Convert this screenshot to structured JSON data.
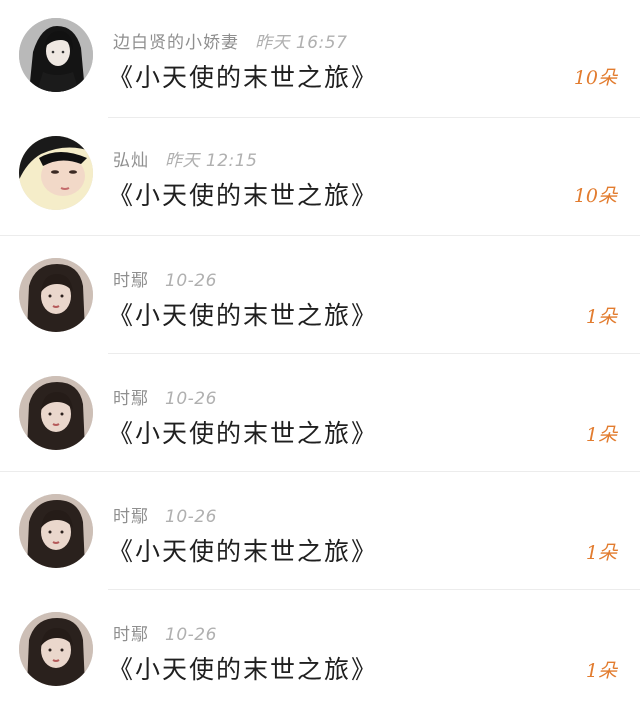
{
  "items": [
    {
      "name": "边白贤的小娇妻",
      "time": "昨天 16:57",
      "title": "《小天使的末世之旅》",
      "count": "10朵"
    },
    {
      "name": "弘灿",
      "time": "昨天 12:15",
      "title": "《小天使的末世之旅》",
      "count": "10朵"
    },
    {
      "name": "时鄢",
      "time": "10-26",
      "title": "《小天使的末世之旅》",
      "count": "1朵"
    },
    {
      "name": "时鄢",
      "time": "10-26",
      "title": "《小天使的末世之旅》",
      "count": "1朵"
    },
    {
      "name": "时鄢",
      "time": "10-26",
      "title": "《小天使的末世之旅》",
      "count": "1朵"
    },
    {
      "name": "时鄢",
      "time": "10-26",
      "title": "《小天使的末世之旅》",
      "count": "1朵"
    }
  ],
  "colors": {
    "count": "#e27c2f",
    "name": "#8f8f8f",
    "time": "#b0b0b0",
    "title": "#1f1f1f"
  }
}
